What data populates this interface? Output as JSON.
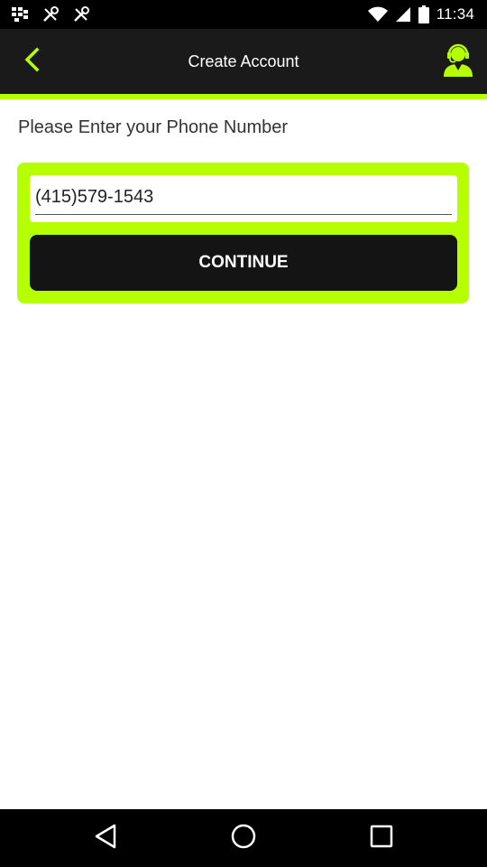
{
  "status_bar": {
    "time": "11:34",
    "icons": [
      "bbm-icon",
      "tools-icon",
      "tools-icon",
      "wifi-icon",
      "signal-icon",
      "battery-icon"
    ]
  },
  "app_bar": {
    "title": "Create Account",
    "back_icon": "back-arrow-icon",
    "support_icon": "support-agent-icon"
  },
  "form": {
    "prompt": "Please Enter your Phone Number",
    "phone_value": "(415)579-1543",
    "continue_label": "CONTINUE"
  },
  "navigation": {
    "icons": [
      "back-triangle-icon",
      "home-circle-icon",
      "recents-square-icon"
    ]
  },
  "colors": {
    "accent": "#b6ff00",
    "app_bar": "#1a1a1a",
    "button": "#141414"
  }
}
